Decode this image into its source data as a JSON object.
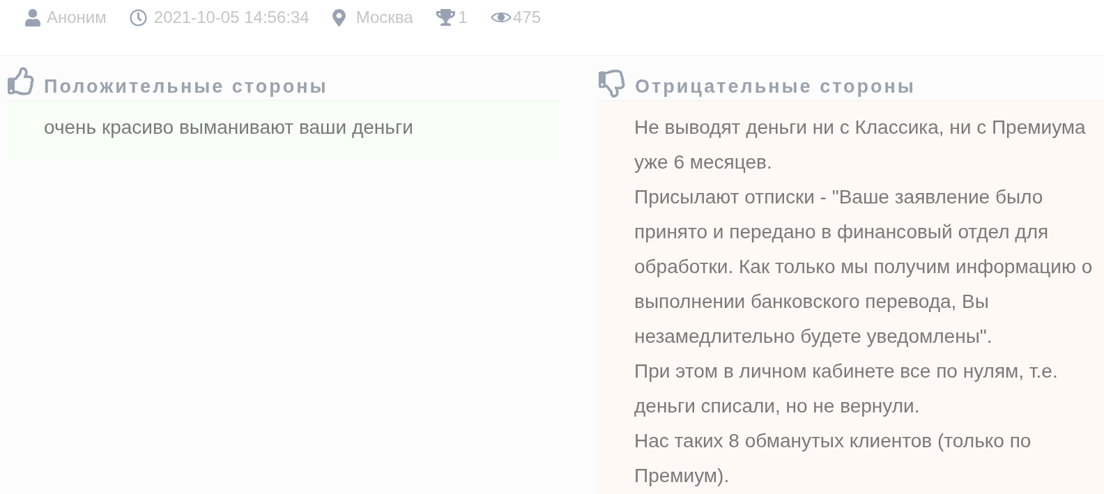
{
  "meta": [
    {
      "kind": "author",
      "text": "Аноним"
    },
    {
      "kind": "date",
      "text": "2021-10-05 14:56:34"
    },
    {
      "kind": "location",
      "text": "Москва"
    },
    {
      "kind": "awards",
      "text": "1"
    },
    {
      "kind": "views",
      "text": "475"
    }
  ],
  "sections": [
    {
      "kind": "pros",
      "title": "Положительные стороны",
      "paragraphs": [
        "очень красиво выманивают ваши деньги"
      ]
    },
    {
      "kind": "cons",
      "title": "Отрицательные стороны",
      "paragraphs": [
        "Не выводят деньги ни с Классика, ни с Премиума уже 6 месяцев.",
        "Присылают отписки - \"Ваше заявление было принято и передано в финансовый отдел для обработки. Как только мы получим информацию о выполнении банковского перевода, Вы незамедлительно будете уведомлены\".",
        "При этом в личном кабинете все по нулям, т.е. деньги списали, но не вернули.",
        "Нас таких 8 обманутых клиентов (только по Премиум)."
      ]
    }
  ]
}
